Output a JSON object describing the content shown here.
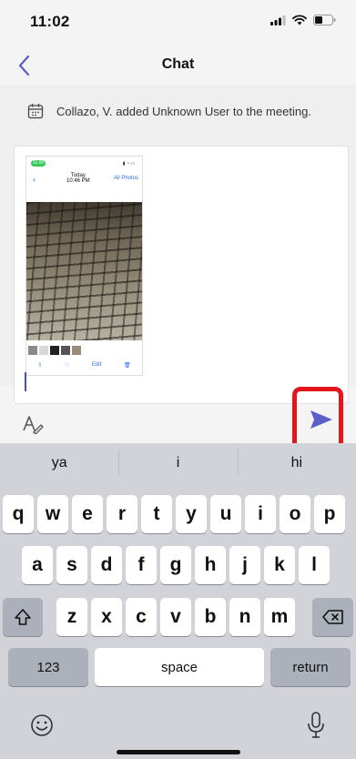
{
  "status_bar": {
    "time": "11:02"
  },
  "nav": {
    "title": "Chat",
    "back_icon": "chevron-left-icon"
  },
  "chat": {
    "system_message": "Collazo, V. added Unknown User to the meeting.",
    "system_icon": "calendar-icon"
  },
  "attachment": {
    "status_time": "11:00",
    "title_line1": "Today",
    "title_line2": "10:46 PM",
    "all_photos": "All Photos",
    "edit_label": "Edit"
  },
  "toolbar": {
    "format_icon": "format-text-icon",
    "send_icon": "send-icon"
  },
  "keyboard": {
    "suggestions": [
      "ya",
      "i",
      "hi"
    ],
    "row1": [
      "q",
      "w",
      "e",
      "r",
      "t",
      "y",
      "u",
      "i",
      "o",
      "p"
    ],
    "row2": [
      "a",
      "s",
      "d",
      "f",
      "g",
      "h",
      "j",
      "k",
      "l"
    ],
    "row3": [
      "z",
      "x",
      "c",
      "v",
      "b",
      "n",
      "m"
    ],
    "numbers_label": "123",
    "space_label": "space",
    "return_label": "return"
  },
  "colors": {
    "accent": "#5b5fc7",
    "highlight_border": "#e2161c",
    "keyboard_bg": "#d1d3d9"
  }
}
